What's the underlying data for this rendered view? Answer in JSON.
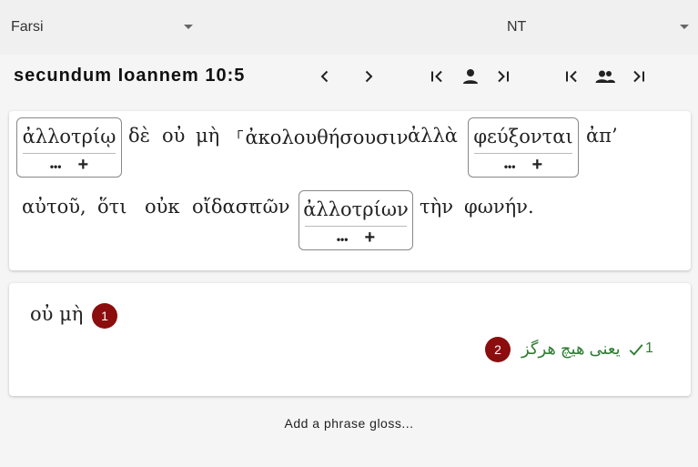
{
  "topbar": {
    "language": "Farsi",
    "corpus": "NT"
  },
  "nav": {
    "reference": "secundum Ioannem 10:5"
  },
  "verse": {
    "words": [
      {
        "text": "ἀλλοτρίῳ",
        "boxed": true
      },
      {
        "text": "δὲ",
        "boxed": false
      },
      {
        "text": "οὐ",
        "boxed": false
      },
      {
        "text": "μὴ",
        "boxed": false
      },
      {
        "text": "⸀ἀκολουθήσουσιν",
        "boxed": false
      },
      {
        "text": "ἀλλὰ",
        "boxed": false
      },
      {
        "text": "φεύξονται",
        "boxed": true
      },
      {
        "text": "ἀπ’",
        "boxed": false
      },
      {
        "text": "αὐτοῦ,",
        "boxed": false
      },
      {
        "text": "ὅτι",
        "boxed": false
      },
      {
        "text": "οὐκ",
        "boxed": false
      },
      {
        "text": "οἴδασι",
        "boxed": false
      },
      {
        "text": "τῶν",
        "boxed": false
      },
      {
        "text": "ἀλλοτρίων",
        "boxed": true
      },
      {
        "text": "τὴν",
        "boxed": false
      },
      {
        "text": "φωνήν.",
        "boxed": false
      }
    ],
    "more_glyph": "•••",
    "add_glyph": "+"
  },
  "phrase": {
    "text": "οὐ μὴ",
    "badge": "1",
    "gloss": {
      "badge": "2",
      "text": "یعنی هیچ هرگز",
      "count": "1",
      "color": "#2e7d32"
    }
  },
  "footer": {
    "add_phrase_label": "Add a phrase gloss..."
  },
  "colors": {
    "badge": "#8b0d0d",
    "topbar": "#f0f0f0"
  }
}
